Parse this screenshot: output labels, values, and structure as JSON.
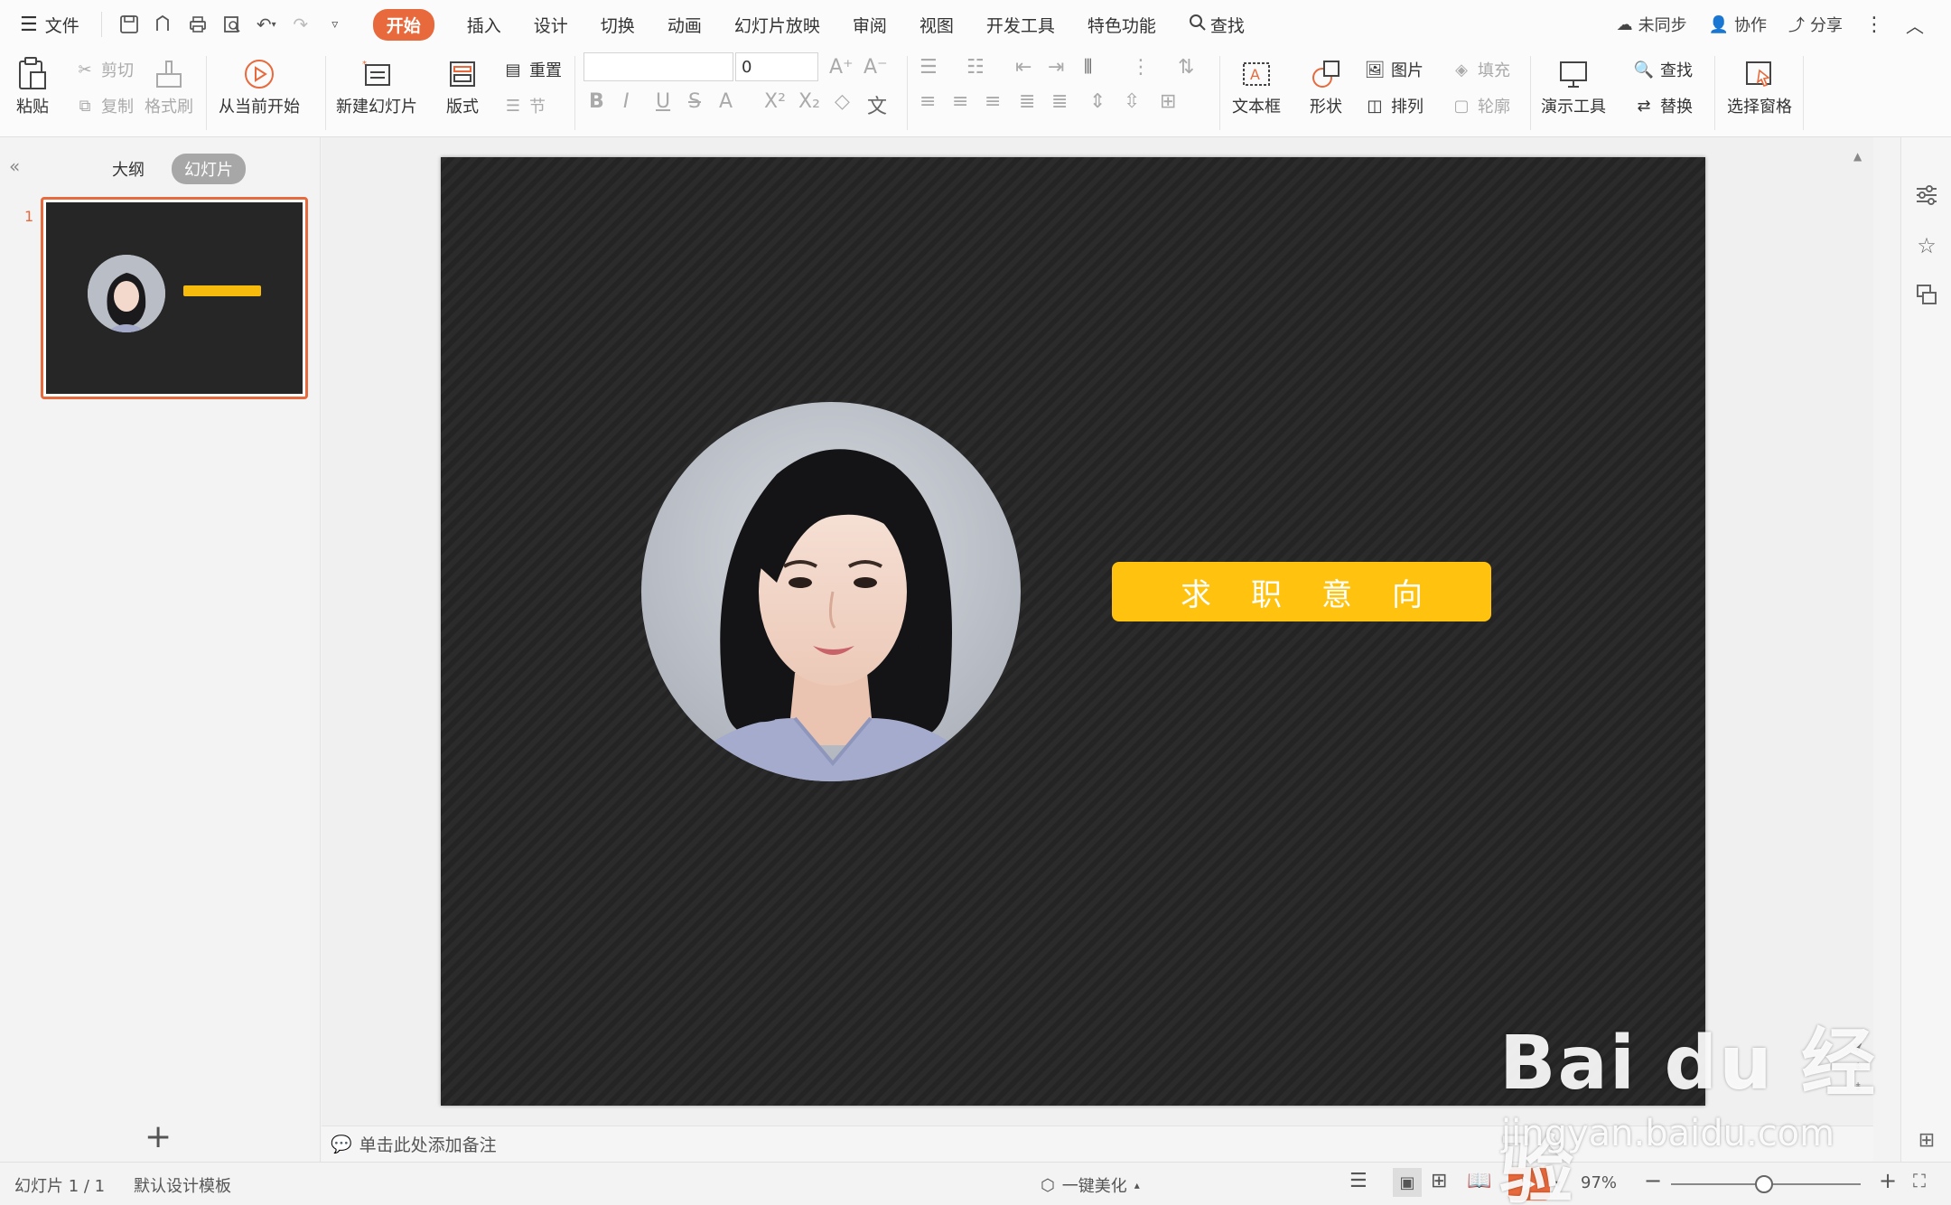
{
  "menubar": {
    "file_label": "文件",
    "tabs": [
      {
        "label": "开始",
        "active": true
      },
      {
        "label": "插入"
      },
      {
        "label": "设计"
      },
      {
        "label": "切换"
      },
      {
        "label": "动画"
      },
      {
        "label": "幻灯片放映"
      },
      {
        "label": "审阅"
      },
      {
        "label": "视图"
      },
      {
        "label": "开发工具"
      },
      {
        "label": "特色功能"
      }
    ],
    "search_label": "查找",
    "sync_label": "未同步",
    "collab_label": "协作",
    "share_label": "分享"
  },
  "ribbon": {
    "paste": "粘贴",
    "cut": "剪切",
    "copy": "复制",
    "format_painter": "格式刷",
    "from_current": "从当前开始",
    "new_slide": "新建幻灯片",
    "layout": "版式",
    "reset": "重置",
    "section": "节",
    "font_size": "0",
    "textbox": "文本框",
    "shape": "形状",
    "picture": "图片",
    "fill": "填充",
    "arrange": "排列",
    "outline": "轮廓",
    "present_tools": "演示工具",
    "find": "查找",
    "replace": "替换",
    "select_pane": "选择窗格"
  },
  "leftpanel": {
    "tab_outline": "大纲",
    "tab_slides": "幻灯片",
    "slide_number": "1"
  },
  "slide": {
    "title_text": "求职意向"
  },
  "notes": {
    "placeholder": "单击此处添加备注"
  },
  "statusbar": {
    "slide_info": "幻灯片 1 / 1",
    "template": "默认设计模板",
    "beautify": "一键美化",
    "zoom": "97%"
  },
  "watermark": {
    "logo_text": "Bai du 经验",
    "url": "jingyan.baidu.com"
  },
  "colors": {
    "accent": "#e8693c",
    "slide_bg": "#262626",
    "title_bar": "#ffc20e"
  }
}
